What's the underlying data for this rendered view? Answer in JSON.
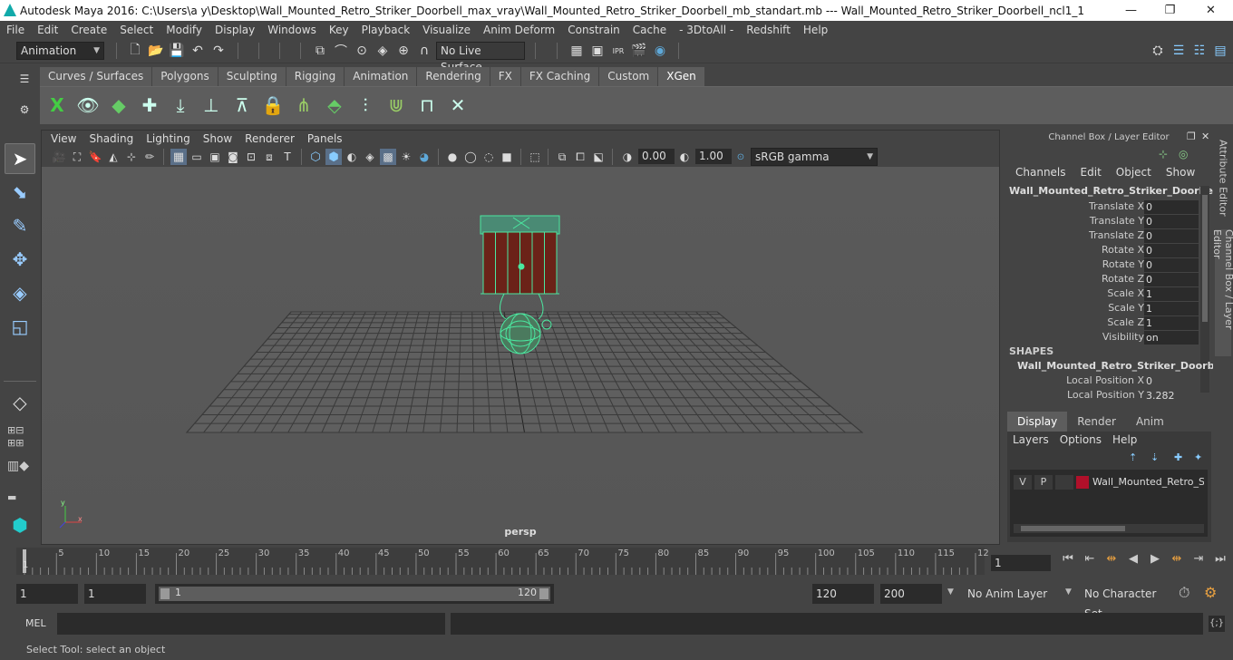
{
  "window": {
    "title": "Autodesk Maya 2016: C:\\Users\\a y\\Desktop\\Wall_Mounted_Retro_Striker_Doorbell_max_vray\\Wall_Mounted_Retro_Striker_Doorbell_mb_standart.mb   ---   Wall_Mounted_Retro_Striker_Doorbell_ncl1_1",
    "minimize": "—",
    "maximize": "❐",
    "close": "✕"
  },
  "menubar": [
    "File",
    "Edit",
    "Create",
    "Select",
    "Modify",
    "Display",
    "Windows",
    "Key",
    "Playback",
    "Visualize",
    "Anim Deform",
    "Constrain",
    "Cache",
    "- 3DtoAll -",
    "Redshift",
    "Help"
  ],
  "statusline": {
    "mode": "Animation",
    "live_surface": "No Live Surface"
  },
  "shelf": {
    "tabs": [
      "Curves / Surfaces",
      "Polygons",
      "Sculpting",
      "Rigging",
      "Animation",
      "Rendering",
      "FX",
      "FX Caching",
      "Custom",
      "XGen"
    ],
    "active_tab": "XGen"
  },
  "viewport": {
    "menu": [
      "View",
      "Shading",
      "Lighting",
      "Show",
      "Renderer",
      "Panels"
    ],
    "exposure": "0.00",
    "gamma": "1.00",
    "color_space": "sRGB gamma",
    "camera_label": "persp"
  },
  "channel_box": {
    "header": "Channel Box / Layer Editor",
    "menu": [
      "Channels",
      "Edit",
      "Object",
      "Show"
    ],
    "object_name": "Wall_Mounted_Retro_Striker_Doorbell...",
    "channels": [
      {
        "label": "Translate X",
        "value": "0"
      },
      {
        "label": "Translate Y",
        "value": "0"
      },
      {
        "label": "Translate Z",
        "value": "0"
      },
      {
        "label": "Rotate X",
        "value": "0"
      },
      {
        "label": "Rotate Y",
        "value": "0"
      },
      {
        "label": "Rotate Z",
        "value": "0"
      },
      {
        "label": "Scale X",
        "value": "1"
      },
      {
        "label": "Scale Y",
        "value": "1"
      },
      {
        "label": "Scale Z",
        "value": "1"
      },
      {
        "label": "Visibility",
        "value": "on"
      }
    ],
    "shapes_header": "SHAPES",
    "shape_name": "Wall_Mounted_Retro_Striker_Doorb...",
    "shape_channels": [
      {
        "label": "Local Position X",
        "value": "0"
      },
      {
        "label": "Local Position Y",
        "value": "3.282"
      }
    ]
  },
  "layer_editor": {
    "tabs": [
      "Display",
      "Render",
      "Anim"
    ],
    "active_tab": "Display",
    "menu": [
      "Layers",
      "Options",
      "Help"
    ],
    "layer": {
      "v": "V",
      "p": "P",
      "name": "Wall_Mounted_Retro_St",
      "color": "#b0102a"
    }
  },
  "side_tabs": [
    "Attribute Editor",
    "Channel Box / Layer Editor"
  ],
  "timeline": {
    "ticks": [
      "5",
      "10",
      "15",
      "20",
      "25",
      "30",
      "35",
      "40",
      "45",
      "50",
      "55",
      "60",
      "65",
      "70",
      "75",
      "80",
      "85",
      "90",
      "95",
      "100",
      "105",
      "110",
      "115",
      "12"
    ],
    "current_frame": "1",
    "start_marker": "1"
  },
  "range": {
    "start": "1",
    "anim_start": "1",
    "slider_start": "1",
    "slider_end": "120",
    "anim_end": "120",
    "end": "200",
    "anim_layer": "No Anim Layer",
    "character_set": "No Character Set"
  },
  "mel": {
    "label": "MEL"
  },
  "help_line": "Select Tool: select an object",
  "colors": {
    "wire": "#4be8a0",
    "accent": "#5ea8d8"
  }
}
